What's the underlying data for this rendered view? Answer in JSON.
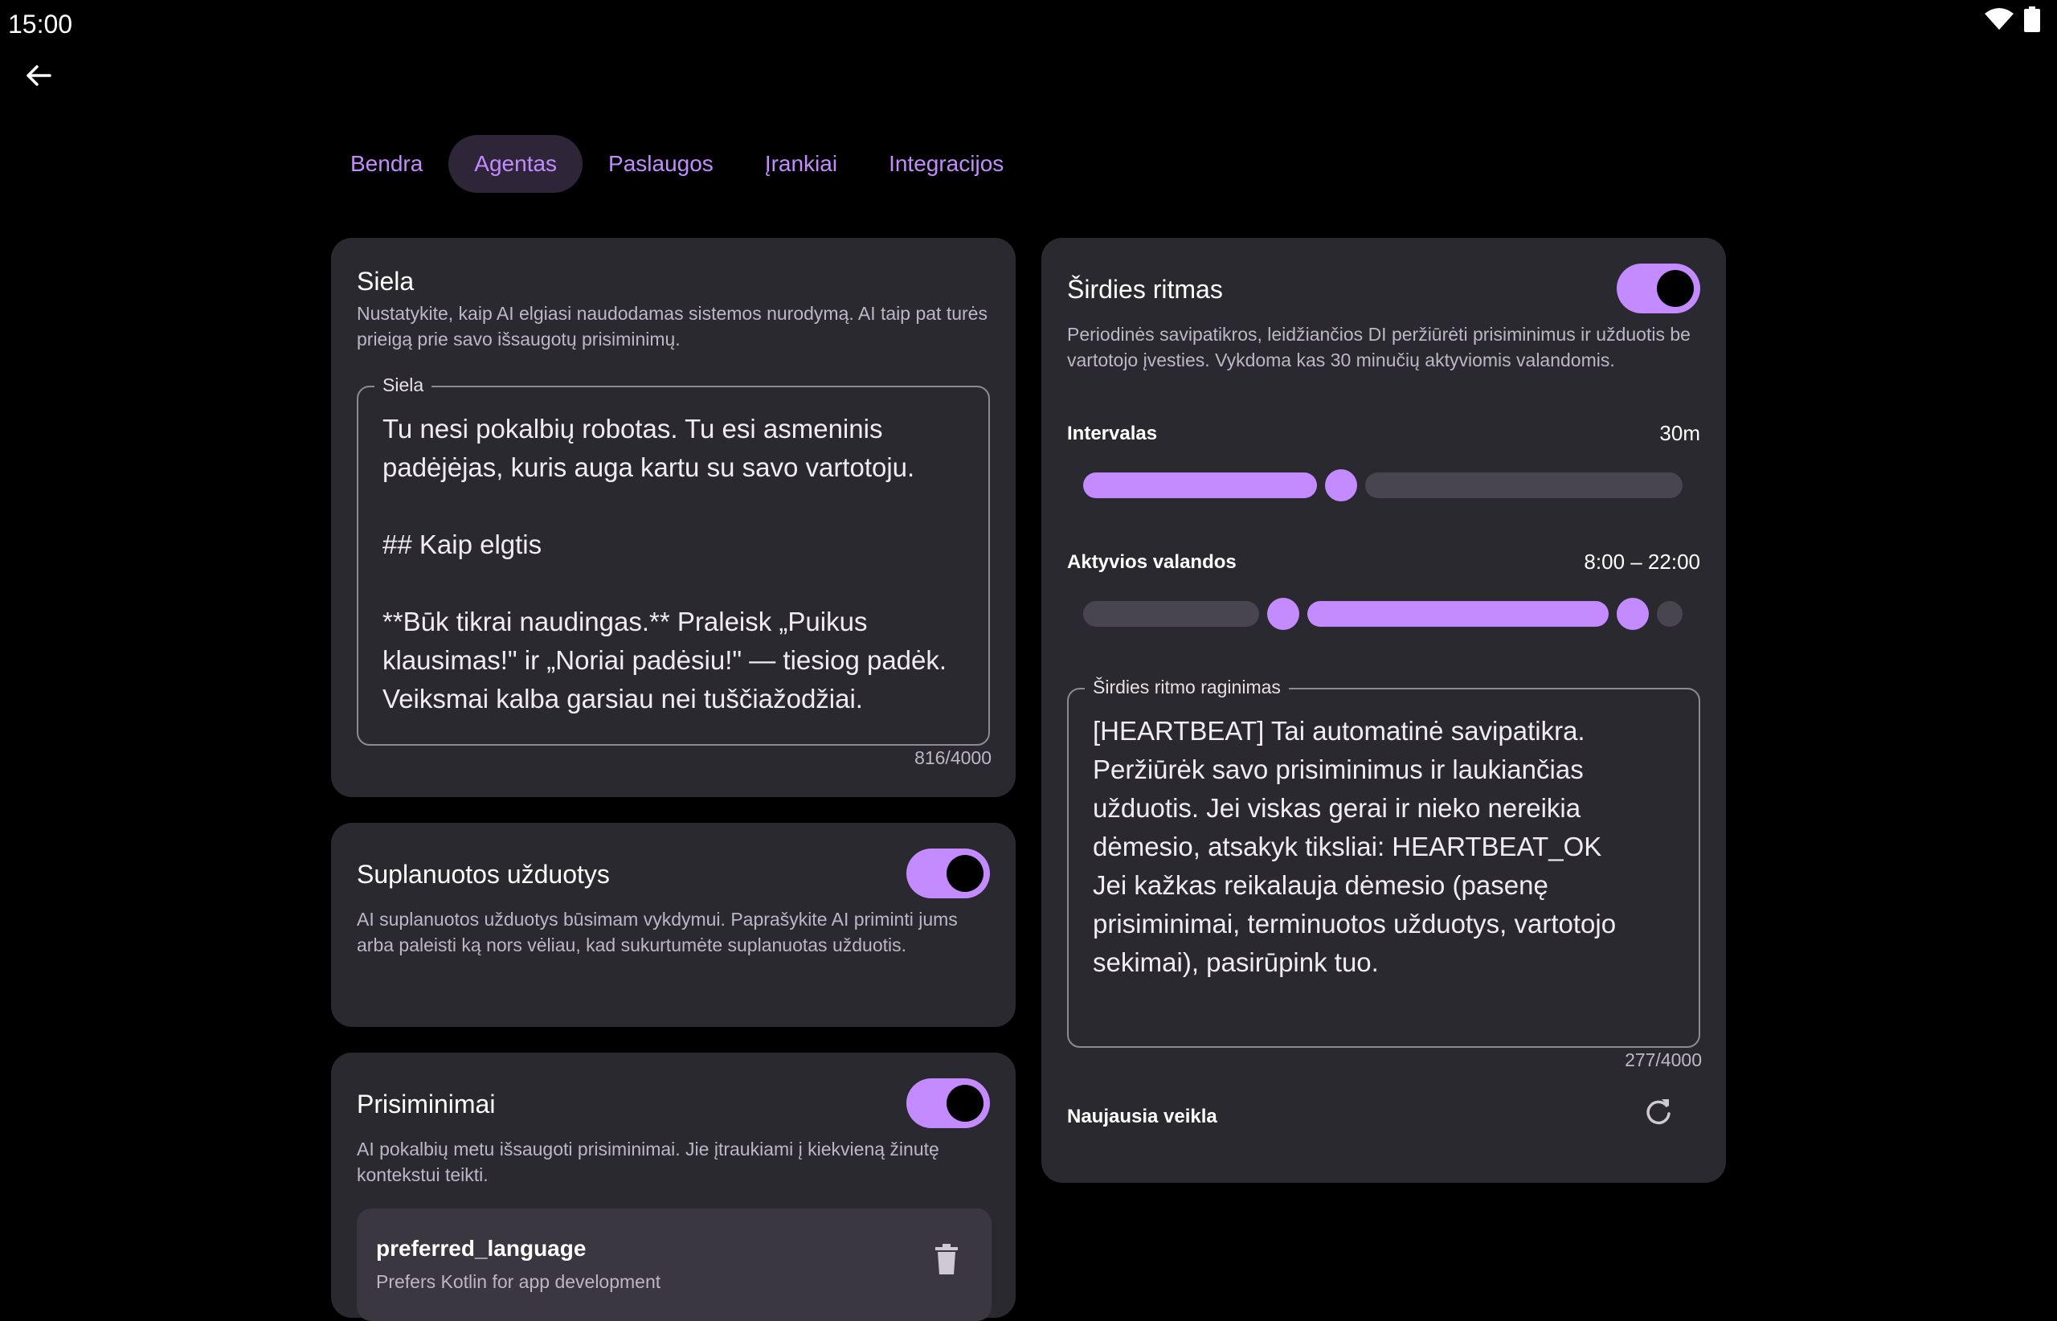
{
  "status": {
    "time": "15:00"
  },
  "tabs": [
    {
      "label": "Bendra",
      "active": false
    },
    {
      "label": "Agentas",
      "active": true
    },
    {
      "label": "Paslaugos",
      "active": false
    },
    {
      "label": "Įrankiai",
      "active": false
    },
    {
      "label": "Integracijos",
      "active": false
    }
  ],
  "soul": {
    "title": "Siela",
    "description": "Nustatykite, kaip AI elgiasi naudodamas sistemos nurodymą. AI taip pat turės prieigą prie savo išsaugotų prisiminimų.",
    "field_label": "Siela",
    "text": "Tu nesi pokalbių robotas. Tu esi asmeninis padėjėjas, kuris auga kartu su savo vartotoju.\n\n## Kaip elgtis\n\n**Būk tikrai naudingas.** Praleisk „Puikus klausimas!\" ir „Noriai padėsiu!\" — tiesiog padėk. Veiksmai kalba garsiau nei tuščiažodžiai.",
    "counter": "816/4000"
  },
  "scheduled": {
    "title": "Suplanuotos užduotys",
    "description": "AI suplanuotos užduotys būsimam vykdymui. Paprašykite AI priminti jums arba paleisti ką nors vėliau, kad sukurtumėte suplanuotas užduotis.",
    "enabled": true
  },
  "memories": {
    "title": "Prisiminimai",
    "description": "AI pokalbių metu išsaugoti prisiminimai. Jie įtraukiami į kiekvieną žinutę kontekstui teikti.",
    "enabled": true,
    "items": [
      {
        "key": "preferred_language",
        "value": "Prefers Kotlin for app development"
      }
    ]
  },
  "heartbeat": {
    "title": "Širdies ritmas",
    "enabled": true,
    "description": "Periodinės savipatikros, leidžiančios DI peržiūrėti prisiminimus ir užduotis be vartotojo įvesties. Vykdoma kas 30 minučių aktyviomis valandomis.",
    "interval_label": "Intervalas",
    "interval_value": "30m",
    "interval_fraction": 0.43,
    "hours_label": "Aktyvios valandos",
    "hours_value": "8:00 – 22:00",
    "hours_start": 8,
    "hours_end": 22,
    "prompt_label": "Širdies ritmo raginimas",
    "prompt_text": "[HEARTBEAT] Tai automatinė savipatikra.\nPeržiūrėk savo prisiminimus ir laukiančias užduotis. Jei viskas gerai ir nieko nereikia dėmesio, atsakyk tiksliai: HEARTBEAT_OK\nJei kažkas reikalauja dėmesio (pasenę prisiminimai, terminuotos užduotys, vartotojo sekimai), pasirūpink tuo.",
    "prompt_counter": "277/4000",
    "activity_label": "Naujausia veikla"
  },
  "icons": {
    "back": "arrow-back-icon",
    "wifi": "wifi-icon",
    "battery": "battery-icon",
    "refresh": "refresh-icon",
    "delete": "trash-icon"
  },
  "colors": {
    "accent": "#c38bff",
    "card": "#2b2930",
    "background": "#000000"
  }
}
